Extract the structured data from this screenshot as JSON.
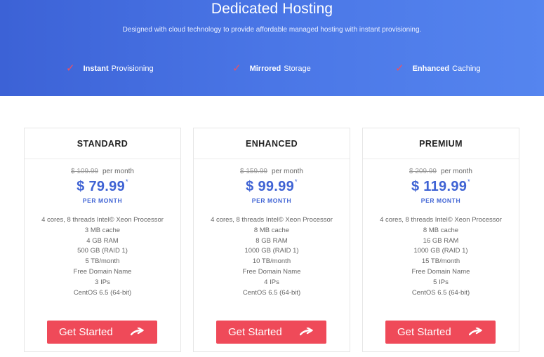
{
  "hero": {
    "title_light": "Dedicated",
    "title_bold": "Hosting",
    "subtitle": "Designed with cloud technology to provide affordable managed hosting with instant provisioning.",
    "features": [
      {
        "bold": "Instant",
        "rest": "Provisioning",
        "icon": "check-icon"
      },
      {
        "bold": "Mirrored",
        "rest": "Storage",
        "icon": "check-icon"
      },
      {
        "bold": "Enhanced",
        "rest": "Caching",
        "icon": "check-icon"
      }
    ]
  },
  "plans": [
    {
      "name": "STANDARD",
      "old_price": "$ 109.99",
      "old_price_suffix": "per month",
      "price": "$ 79.99",
      "price_mark": "*",
      "period": "PER MONTH",
      "specs": [
        "4 cores, 8 threads Intel© Xeon Processor",
        "3 MB cache",
        "4 GB RAM",
        "500 GB (RAID 1)",
        "5 TB/month",
        "Free Domain Name",
        "3 IPs",
        "CentOS 6.5 (64-bit)"
      ],
      "cta": "Get Started"
    },
    {
      "name": "ENHANCED",
      "old_price": "$ 159.99",
      "old_price_suffix": "per month",
      "price": "$ 99.99",
      "price_mark": "*",
      "period": "PER MONTH",
      "specs": [
        "4 cores, 8 threads Intel© Xeon Processor",
        "8 MB cache",
        "8 GB RAM",
        "1000 GB (RAID 1)",
        "10 TB/month",
        "Free Domain Name",
        "4 IPs",
        "CentOS 6.5 (64-bit)"
      ],
      "cta": "Get Started"
    },
    {
      "name": "PREMIUM",
      "old_price": "$ 209.99",
      "old_price_suffix": "per month",
      "price": "$ 119.99",
      "price_mark": "*",
      "period": "PER MONTH",
      "specs": [
        "4 cores, 8 threads Intel© Xeon Processor",
        "8 MB cache",
        "16 GB RAM",
        "1000 GB (RAID 1)",
        "15 TB/month",
        "Free Domain Name",
        "5 IPs",
        "CentOS 6.5 (64-bit)"
      ],
      "cta": "Get Started"
    }
  ],
  "colors": {
    "hero_gradient_start": "#3c62d6",
    "hero_gradient_end": "#5585ef",
    "accent_red": "#ef4a59",
    "price_blue": "#3f63d4"
  },
  "icons": {
    "feature": "check-icon",
    "cta": "arrow-right-icon"
  }
}
